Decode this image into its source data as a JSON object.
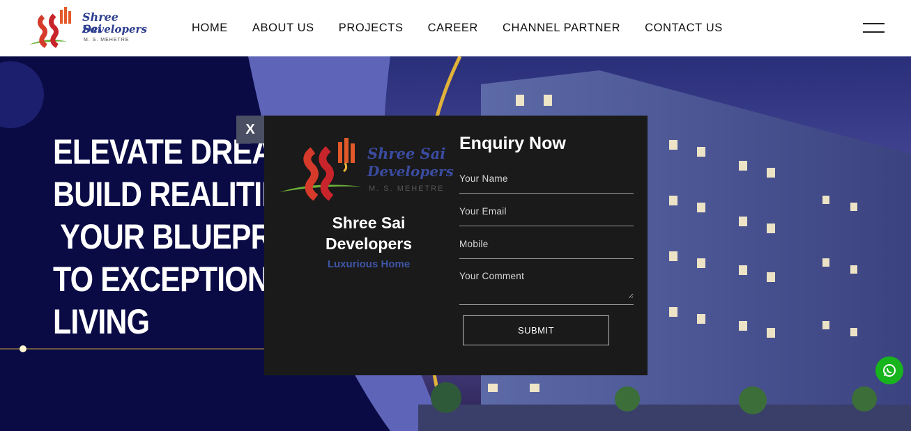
{
  "brand": {
    "name_line1": "Shree Sai",
    "name_line2": "Developers",
    "sub": "M. S. MEHETRE"
  },
  "nav": {
    "items": [
      "HOME",
      "ABOUT US",
      "PROJECTS",
      "CAREER",
      "CHANNEL PARTNER",
      "CONTACT US"
    ]
  },
  "hero": {
    "headline": "ELEVATE DREAMS,\nBUILD REALITIES:\n YOUR BLUEPRINT\nTO EXCEPTIONAL\nLIVING"
  },
  "modal": {
    "close_label": "X",
    "brand_line1": "Shree Sai",
    "brand_line2": "Developers",
    "tagline": "Luxurious Home",
    "logo_line1": "Shree Sai",
    "logo_line2": "Developers",
    "logo_sub": "M. S. MEHETRE",
    "title": "Enquiry Now",
    "name_placeholder": "Your Name",
    "email_placeholder": "Your Email",
    "mobile_placeholder": "Mobile",
    "comment_placeholder": "Your Comment",
    "submit_label": "SUBMIT"
  },
  "icons": {
    "menu": "hamburger-menu-icon",
    "whatsapp": "whatsapp-icon"
  },
  "colors": {
    "modal_bg": "#1a1a1a",
    "brand_blue": "#3f55a6",
    "whatsapp_green": "#18b41e",
    "hero_navy": "#0a0b45"
  }
}
